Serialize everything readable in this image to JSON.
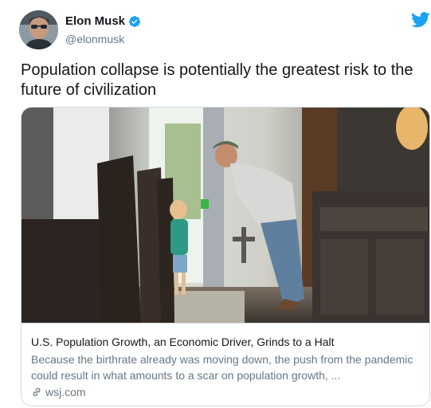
{
  "author": {
    "display_name": "Elon Musk",
    "handle": "@elonmusk",
    "verified": true
  },
  "tweet": {
    "text": "Population collapse is potentially the greatest risk to the future of civilization"
  },
  "card": {
    "title": "U.S. Population Growth, an Economic Driver, Grinds to a Halt",
    "description": "Because the birthrate already was moving down, the push from the pandemic could result in what amounts to a scar on population growth, ...",
    "domain": "wsj.com",
    "image_icon": "photo-man-and-toddler-in-dining-room"
  },
  "colors": {
    "twitter_blue": "#1da1f2",
    "text_primary": "#14171a",
    "text_secondary": "#657786",
    "border": "#cfd9de"
  },
  "icons": {
    "verified": "verified-badge-icon",
    "brand": "twitter-bird-icon",
    "link": "link-icon"
  }
}
